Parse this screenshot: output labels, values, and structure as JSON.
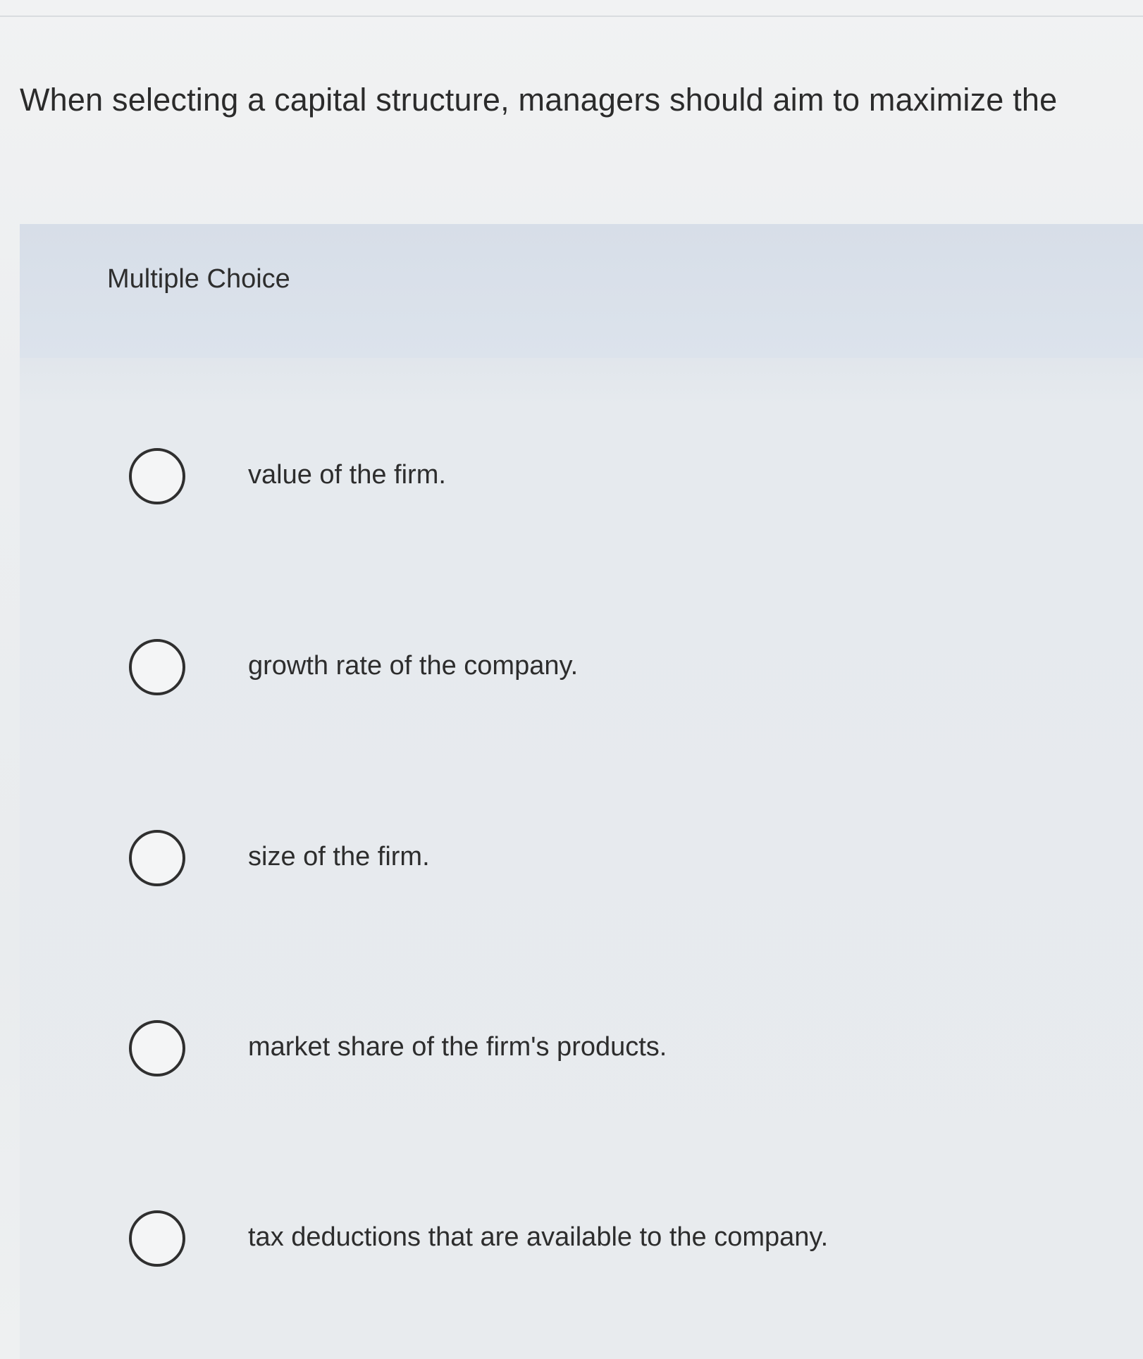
{
  "question": {
    "text": "When selecting a capital structure, managers should aim to maximize the"
  },
  "multiple_choice": {
    "header_label": "Multiple Choice",
    "options": [
      {
        "label": "value of the firm."
      },
      {
        "label": "growth rate of the company."
      },
      {
        "label": "size of the firm."
      },
      {
        "label": "market share of the firm's products."
      },
      {
        "label": "tax deductions that are available to the company."
      }
    ],
    "selected_index": null
  }
}
